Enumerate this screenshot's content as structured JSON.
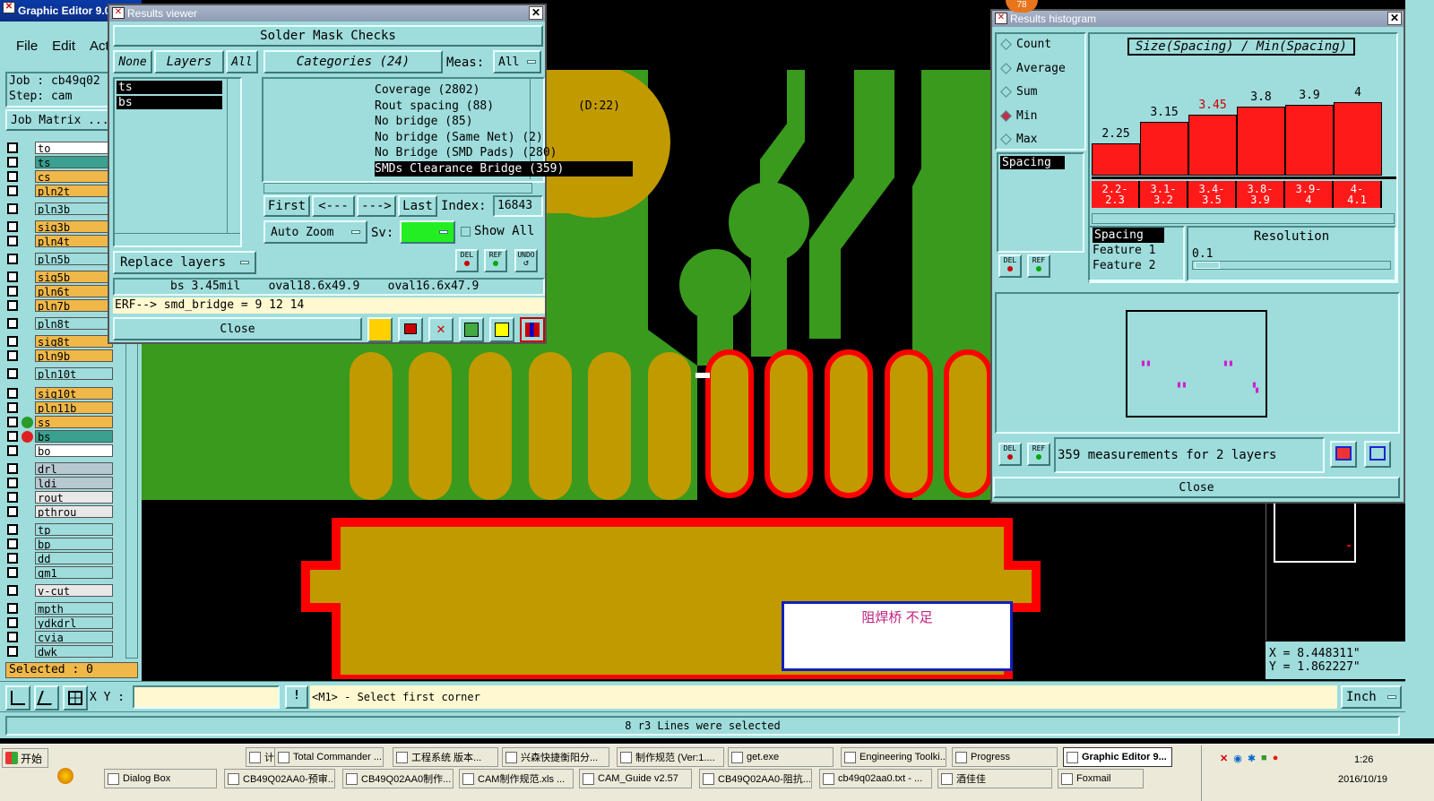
{
  "graphic_editor": {
    "title": "Graphic Editor 9.0",
    "menu": [
      "File",
      "Edit",
      "Act"
    ],
    "job_label": "Job : cb49q02",
    "step_label": "Step: cam",
    "job_matrix_button": "Job Matrix ...",
    "layers": [
      {
        "name": "to",
        "color": "#ffffff"
      },
      {
        "name": "ts",
        "color": "#3aa090"
      },
      {
        "name": "cs",
        "color": "#f0b848"
      },
      {
        "name": "pln2t",
        "color": "#f0b848"
      },
      {
        "name": "pln3b",
        "color": "#9fdcdc"
      },
      {
        "name": "sig3b",
        "color": "#f0b848"
      },
      {
        "name": "pln4t",
        "color": "#f0b848"
      },
      {
        "name": "pln5b",
        "color": "#9fdcdc"
      },
      {
        "name": "sig5b",
        "color": "#f0b848"
      },
      {
        "name": "pln6t",
        "color": "#f0b848"
      },
      {
        "name": "pln7b",
        "color": "#f0b848"
      },
      {
        "name": "pln8t",
        "color": "#9fdcdc"
      },
      {
        "name": "sig8t",
        "color": "#f0b848"
      },
      {
        "name": "pln9b",
        "color": "#f0b848"
      },
      {
        "name": "pln10t",
        "color": "#9fdcdc"
      },
      {
        "name": "sig10t",
        "color": "#f0b848"
      },
      {
        "name": "pln11b",
        "color": "#f0b848"
      },
      {
        "name": "ss",
        "color": "#f0b848"
      },
      {
        "name": "bs",
        "color": "#3aa090"
      },
      {
        "name": "bo",
        "color": "#ffffff"
      },
      {
        "name": "drl",
        "color": "#b8c8d0"
      },
      {
        "name": "ldi",
        "color": "#b8c8d0"
      },
      {
        "name": "rout",
        "color": "#e8e8e8"
      },
      {
        "name": "pthrou",
        "color": "#e8e8e8"
      },
      {
        "name": "tp",
        "color": "#9fdcdc"
      },
      {
        "name": "bp",
        "color": "#9fdcdc"
      },
      {
        "name": "dd",
        "color": "#9fdcdc"
      },
      {
        "name": "gm1",
        "color": "#9fdcdc"
      },
      {
        "name": "v-cut",
        "color": "#e8e8e8"
      },
      {
        "name": "mpth",
        "color": "#9fdcdc"
      },
      {
        "name": "ydkdrl",
        "color": "#9fdcdc"
      },
      {
        "name": "cvia",
        "color": "#9fdcdc"
      },
      {
        "name": "dwk",
        "color": "#9fdcdc"
      }
    ],
    "selected_label": "Selected : 0",
    "xy_label": "X Y :",
    "prompt": "<M1> - Select first corner",
    "units": "Inch",
    "status_line": "8 r3 Lines were selected",
    "coord_x": "X  =  8.448311\"",
    "coord_y": "Y  =  1.862227\"",
    "annotation": "阻焊桥 不足",
    "notification_badge": "78"
  },
  "results_viewer": {
    "title": "Results viewer",
    "header": "Solder Mask Checks",
    "none_btn": "None",
    "layers_btn": "Layers",
    "all_btn": "All",
    "categories_btn": "Categories (24)",
    "meas_label": "Meas:",
    "meas_value": "All",
    "layer_list": [
      "ts",
      "bs"
    ],
    "categories": [
      "Coverage (2802)",
      "Rout spacing (88)            (D:22)",
      "No bridge (85)",
      "No bridge (Same Net) (2)",
      "No Bridge (SMD Pads) (280)",
      "SMDs Clearance Bridge (359)"
    ],
    "first_btn": "First",
    "prev_btn": "<---",
    "next_btn": "--->",
    "last_btn": "Last",
    "index_label": "Index:",
    "index_value": "16843",
    "auto_zoom": "Auto Zoom",
    "sv_label": "Sv:",
    "show_all": "Show All",
    "replace_layers": "Replace layers",
    "del_label": "DEL",
    "ref_label": "REF",
    "undo_label": "UNDO",
    "measure_line": "bs 3.45mil    oval18.6x49.9    oval16.6x47.9",
    "erf_line": "ERF--> smd_bridge = 9 12 14",
    "close": "Close"
  },
  "histogram": {
    "title": "Results histogram",
    "options": [
      "Count",
      "Average",
      "Sum",
      "Min",
      "Max"
    ],
    "selected_option": "Min",
    "chart_title": "Size(Spacing) / Min(Spacing)",
    "bins": [
      {
        "label": "2.2-\n2.3",
        "value": 2.25
      },
      {
        "label": "3.1-\n3.2",
        "value": 3.15
      },
      {
        "label": "3.4-\n3.5",
        "value": 3.45
      },
      {
        "label": "3.8-\n3.9",
        "value": 3.8
      },
      {
        "label": "3.9-\n4",
        "value": 3.9
      },
      {
        "label": "4-\n4.1",
        "value": 4
      }
    ],
    "value_labels": [
      "2.25",
      "3.15",
      "3.45",
      "3.8",
      "3.9",
      "4"
    ],
    "highlighted_value": "3.45",
    "left_list": [
      "Spacing"
    ],
    "feature_list": [
      "Spacing",
      "Feature 1",
      "Feature 2"
    ],
    "resolution_label": "Resolution",
    "resolution_value": "0.1",
    "summary": "359 measurements for 2 layers",
    "close": "Close"
  },
  "taskbar": {
    "start": "开始",
    "row1": [
      "计算器",
      "Total Commander ...",
      "工程系统  版本...",
      "兴森快捷衡阳分...",
      "制作规范 (Ver:1....",
      "get.exe",
      "Engineering Toolki...",
      "Progress",
      "Graphic Editor 9..."
    ],
    "row2": [
      "Dialog Box",
      "CB49Q02AA0-预审...",
      "CB49Q02AA0制作...",
      "CAM制作规范.xls  ...",
      "CAM_Guide v2.57",
      "CB49Q02AA0-阻抗...",
      "cb49q02aa0.txt - ...",
      "酒佳佳",
      "Foxmail"
    ],
    "time": "1:26",
    "date": "2016/10/19"
  },
  "colors": {
    "teal": "#9fdcdc",
    "pcb_green": "#3a9a1e",
    "copper": "#c19a00",
    "violation_red": "#ff0000",
    "accent_red": "#cc0000"
  }
}
